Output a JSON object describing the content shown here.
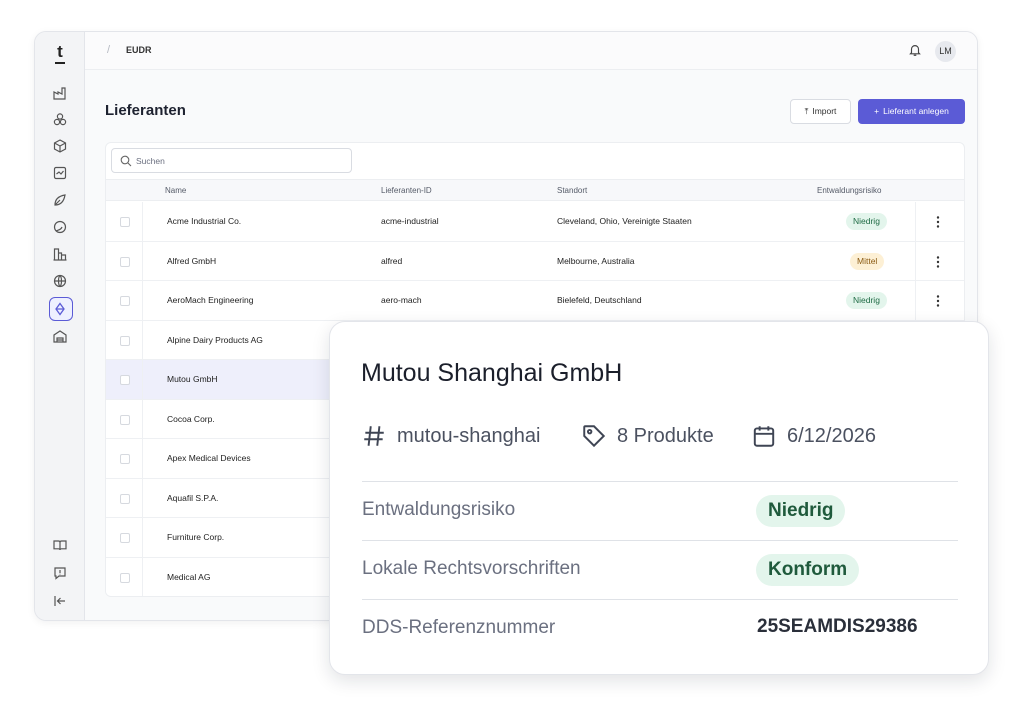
{
  "breadcrumb": {
    "separator": "/",
    "current": "EUDR"
  },
  "user": {
    "initials": "LM"
  },
  "sidebar": {
    "logo": "t",
    "icons": [
      "factory-icon",
      "cubes-icon",
      "box-icon",
      "chart-icon",
      "leaf-icon",
      "globe-swirl-icon",
      "buildings-icon",
      "globe-icon",
      "supplier-network-icon",
      "warehouse-icon"
    ],
    "active": "supplier-network-icon",
    "bottom_icons": [
      "book-icon",
      "chat-icon",
      "collapse-icon"
    ]
  },
  "page": {
    "title": "Lieferanten",
    "import_label": "Import",
    "add_label": "Lieferant anlegen"
  },
  "search": {
    "placeholder": "Suchen"
  },
  "table": {
    "headers": {
      "name": "Name",
      "id": "Lieferanten-ID",
      "location": "Standort",
      "risk": "Entwaldungsrisiko"
    },
    "rows": [
      {
        "name": "Acme Industrial Co.",
        "id": "acme-industrial",
        "location": "Cleveland, Ohio, Vereinigte Staaten",
        "risk": "Niedrig"
      },
      {
        "name": "Alfred GmbH",
        "id": "alfred",
        "location": "Melbourne, Australia",
        "risk": "Mittel"
      },
      {
        "name": "AeroMach Engineering",
        "id": "aero-mach",
        "location": "Bielefeld, Deutschland",
        "risk": "Niedrig"
      },
      {
        "name": "Alpine Dairy Products AG"
      },
      {
        "name": "Mutou GmbH"
      },
      {
        "name": "Cocoa Corp."
      },
      {
        "name": "Apex Medical Devices"
      },
      {
        "name": "Aquafil S.P.A."
      },
      {
        "name": "Furniture Corp."
      },
      {
        "name": "Medical AG"
      }
    ]
  },
  "detail": {
    "title": "Mutou Shanghai GmbH",
    "slug": "mutou-shanghai",
    "products": "8 Produkte",
    "date": "6/12/2026",
    "rows": [
      {
        "label": "Entwaldungsrisiko",
        "value": "Niedrig"
      },
      {
        "label": "Lokale Rechtsvorschriften",
        "value": "Konform"
      },
      {
        "label": "DDS-Referenznummer",
        "value": "25SEAMDIS29386"
      }
    ]
  },
  "colors": {
    "accent": "#5b5bd6",
    "badge_low": "#e3f5ec",
    "badge_mid": "#fdf0d5",
    "selected_row": "#eeeffb"
  }
}
